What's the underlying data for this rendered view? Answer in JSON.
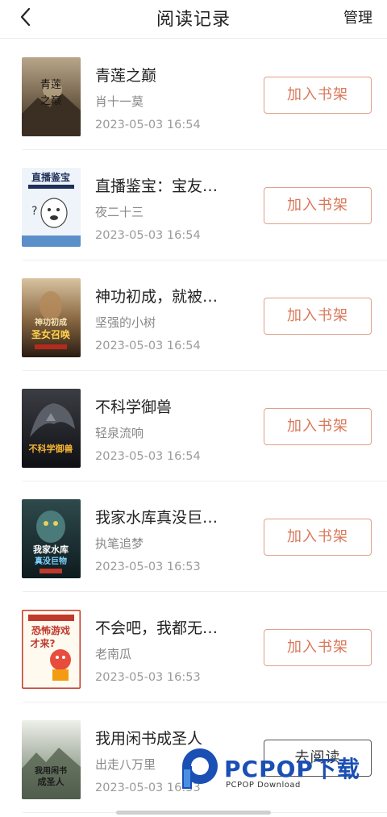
{
  "header": {
    "title": "阅读记录",
    "manage_label": "管理",
    "back_icon": "chevron-left-icon"
  },
  "books": [
    {
      "title": "青莲之巅",
      "author": "肖十一莫",
      "time": "2023-05-03 16:54",
      "button": "加入书架",
      "cover_text": "青莲之巅"
    },
    {
      "title": "直播鉴宝：宝友…",
      "author": "夜二十三",
      "time": "2023-05-03 16:54",
      "button": "加入书架",
      "cover_text": "直播鉴宝"
    },
    {
      "title": "神功初成，就被…",
      "author": "坚强的小树",
      "time": "2023-05-03 16:54",
      "button": "加入书架",
      "cover_text": "神功初成 圣女召唤"
    },
    {
      "title": "不科学御兽",
      "author": "轻泉流响",
      "time": "2023-05-03 16:54",
      "button": "加入书架",
      "cover_text": "不科学御兽"
    },
    {
      "title": "我家水库真没巨…",
      "author": "执笔追梦",
      "time": "2023-05-03 16:53",
      "button": "加入书架",
      "cover_text": "我家水库 真没巨物"
    },
    {
      "title": "不会吧，我都无…",
      "author": "老南瓜",
      "time": "2023-05-03 16:53",
      "button": "加入书架",
      "cover_text": "恐怖游戏 才来?"
    },
    {
      "title": "我用闲书成圣人",
      "author": "出走八万里",
      "time": "2023-05-03 16:53",
      "button": "去阅读",
      "cover_text": "我用闲书 成圣人"
    }
  ],
  "watermark": {
    "brand": "PCPOP下载",
    "sub": "PCPOP Download"
  },
  "colors": {
    "accent": "#d9785a",
    "accent_border": "#e0a08c",
    "watermark_blue": "#1a4fb4"
  }
}
